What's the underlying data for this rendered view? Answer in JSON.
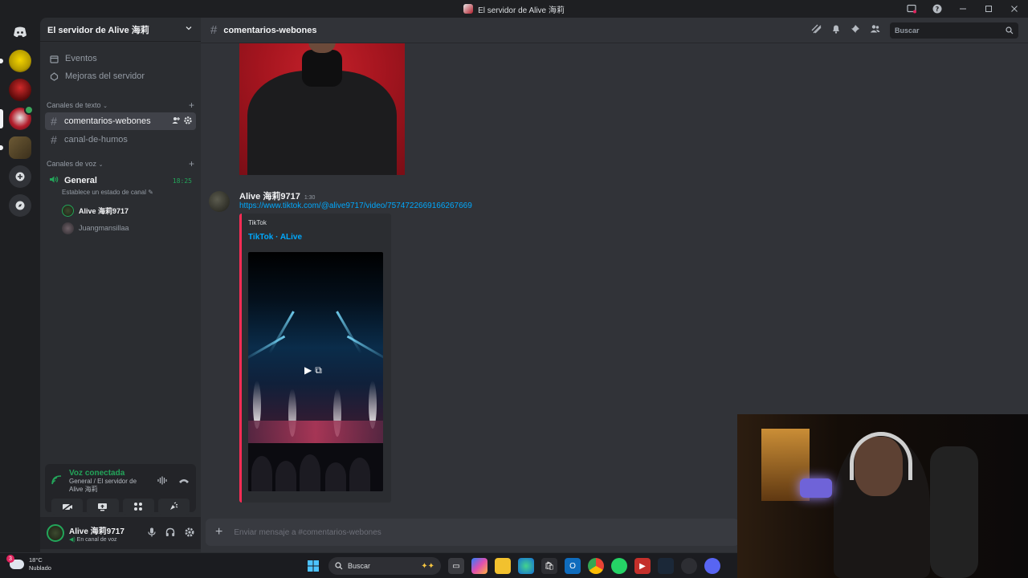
{
  "window": {
    "title": "El servidor de Alive 海莉"
  },
  "sidebar": {
    "server_name": "El servidor de Alive 海莉",
    "items": [
      {
        "label": "Eventos"
      },
      {
        "label": "Mejoras del servidor"
      }
    ],
    "text_category": "Canales de texto",
    "text_channels": [
      {
        "name": "comentarios-webones",
        "active": true
      },
      {
        "name": "canal-de-humos",
        "active": false
      }
    ],
    "voice_category": "Canales de voz",
    "voice_channel": {
      "name": "General",
      "time": "18:25",
      "status_placeholder": "Establece un estado de canal",
      "users": [
        {
          "name": "Alive 海莉9717"
        },
        {
          "name": "Juangmansillaa"
        }
      ]
    }
  },
  "voice_panel": {
    "title": "Voz conectada",
    "subtitle": "General / El servidor de Alive 海莉"
  },
  "user_panel": {
    "username": "Alive 海莉9717",
    "status": "En canal de voz"
  },
  "channel": {
    "name": "comentarios-webones",
    "search_placeholder": "Buscar"
  },
  "message": {
    "author": "Alive 海莉9717",
    "time": "1:30",
    "link": "https://www.tiktok.com/@alive9717/video/7574722669166267669",
    "embed_provider": "TikTok",
    "embed_title": "TikTok · ALive"
  },
  "composer": {
    "placeholder": "Enviar mensaje a #comentarios-webones"
  },
  "taskbar": {
    "weather_temp": "18°C",
    "weather_desc": "Nublado",
    "weather_badge": "3",
    "search_label": "Buscar"
  },
  "colors": {
    "accent_green": "#23a55a",
    "link_blue": "#00a8fc",
    "tiktok_red": "#fe2c55"
  }
}
